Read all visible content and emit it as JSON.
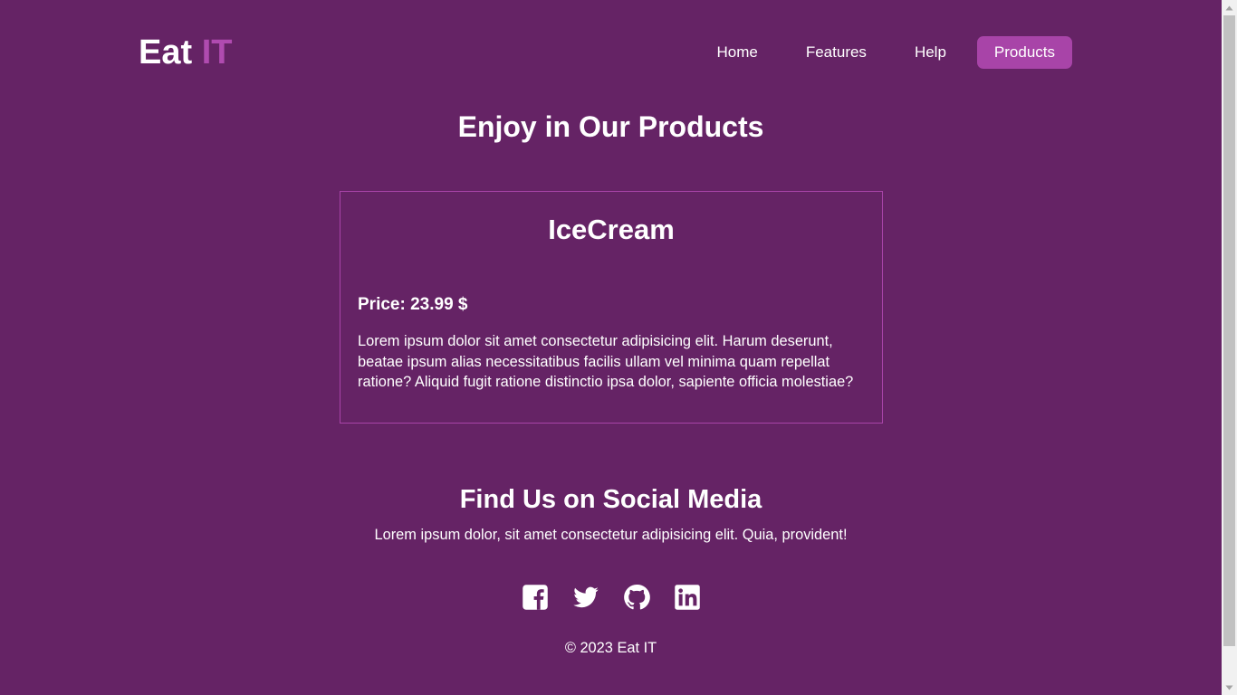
{
  "brand": {
    "name_main": "Eat",
    "name_accent": "IT",
    "accent_color": "#b04bb0"
  },
  "nav": {
    "items": [
      {
        "label": "Home",
        "active": false
      },
      {
        "label": "Features",
        "active": false
      },
      {
        "label": "Help",
        "active": false
      },
      {
        "label": "Products",
        "active": true
      }
    ]
  },
  "products": {
    "title": "Enjoy in Our Products",
    "items": [
      {
        "name": "IceCream",
        "price_label": "Price: 23.99 $",
        "description": "Lorem ipsum dolor sit amet consectetur adipisicing elit. Harum deserunt, beatae ipsum alias necessitatibus facilis ullam vel minima quam repellat ratione? Aliquid fugit ratione distinctio ipsa dolor, sapiente officia molestiae?"
      }
    ]
  },
  "social": {
    "title": "Find Us on Social Media",
    "text": "Lorem ipsum dolor, sit amet consectetur adipisicing elit. Quia, provident!",
    "icons": [
      "facebook-icon",
      "twitter-icon",
      "github-icon",
      "linkedin-icon"
    ]
  },
  "footer": {
    "copyright": "© 2023 Eat IT"
  },
  "colors": {
    "background": "#652365",
    "active_nav": "#a844a8",
    "card_border": "#a844a8",
    "text": "#ffffff"
  }
}
